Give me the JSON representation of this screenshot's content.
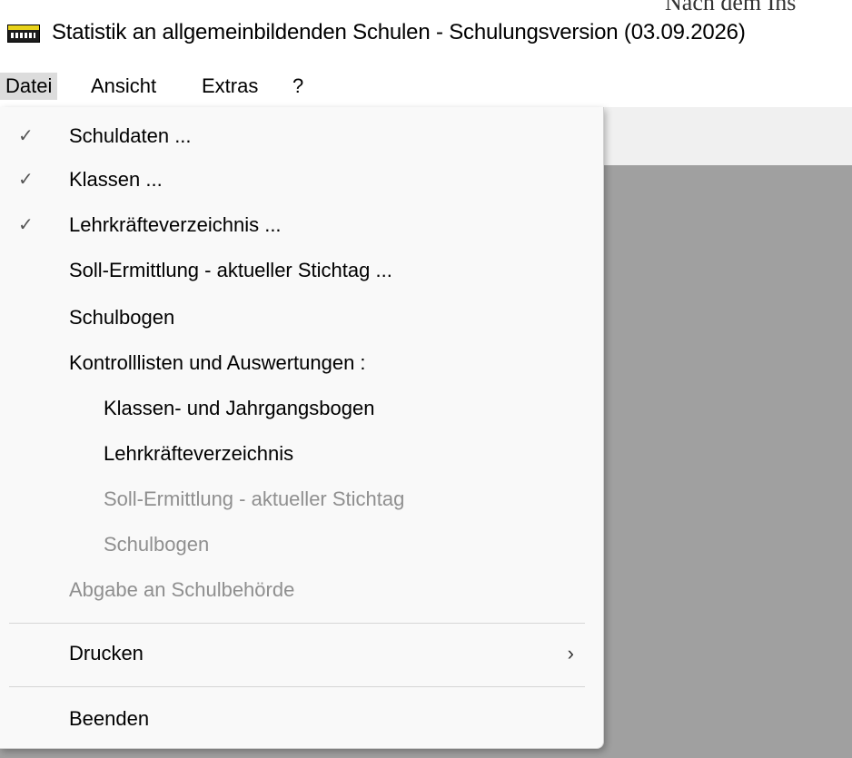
{
  "window": {
    "title": "Statistik an allgemeinbildenden Schulen - Schulungsversion (03.09.2026)",
    "background_clip_text": "Nach dem Ins"
  },
  "menubar": {
    "items": [
      {
        "label": "Datei",
        "active": true
      },
      {
        "label": "Ansicht"
      },
      {
        "label": "Extras"
      },
      {
        "label": "?"
      }
    ]
  },
  "dropdown": {
    "items": [
      {
        "label": "Schuldaten ...",
        "checked": true,
        "check_mark": "✓",
        "enabled": true
      },
      {
        "label": "Klassen ...",
        "checked": true,
        "check_mark": "✓",
        "enabled": true
      },
      {
        "label": "Lehrkräfteverzeichnis ...",
        "checked": true,
        "check_mark": "✓",
        "enabled": true
      },
      {
        "label": "Soll-Ermittlung - aktueller Stichtag ...",
        "checked": false,
        "enabled": true
      },
      {
        "label": "Schulbogen",
        "checked": false,
        "enabled": true
      },
      {
        "label": "Kontrolllisten und Auswertungen :",
        "checked": false,
        "enabled": true
      },
      {
        "label": "Klassen- und Jahrgangsbogen",
        "indent": true,
        "enabled": true
      },
      {
        "label": "Lehrkräfteverzeichnis",
        "indent": true,
        "enabled": true
      },
      {
        "label": "Soll-Ermittlung - aktueller Stichtag",
        "indent": true,
        "enabled": false
      },
      {
        "label": "Schulbogen",
        "indent": true,
        "enabled": false
      },
      {
        "label": "Abgabe an Schulbehörde",
        "enabled": false
      },
      {
        "label": "Drucken",
        "submenu": true,
        "chevron": "›",
        "enabled": true
      },
      {
        "label": "Beenden",
        "enabled": true
      }
    ]
  },
  "colors": {
    "workspace": "#a0a0a0",
    "menu_bg": "#f9f9f9",
    "disabled_text": "#8f8f8f"
  }
}
